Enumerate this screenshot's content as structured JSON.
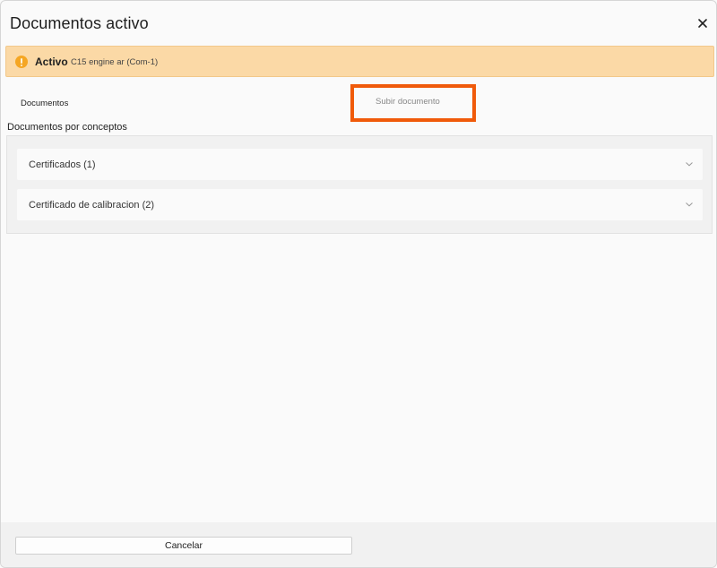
{
  "dialog": {
    "title": "Documentos activo"
  },
  "banner": {
    "label": "Activo",
    "value": "C15 engine ar (Com-1)",
    "color": "#fbd9a6",
    "icon": "warning-circle-icon"
  },
  "tabs": [
    {
      "label": "Documentos"
    },
    {
      "label": "Subir documento"
    }
  ],
  "highlight_color": "#f05a0a",
  "section": {
    "title": "Documentos por conceptos",
    "items": [
      {
        "label": "Certificados (1)"
      },
      {
        "label": "Certificado de calibracion (2)"
      }
    ]
  },
  "footer": {
    "cancel_label": "Cancelar"
  }
}
